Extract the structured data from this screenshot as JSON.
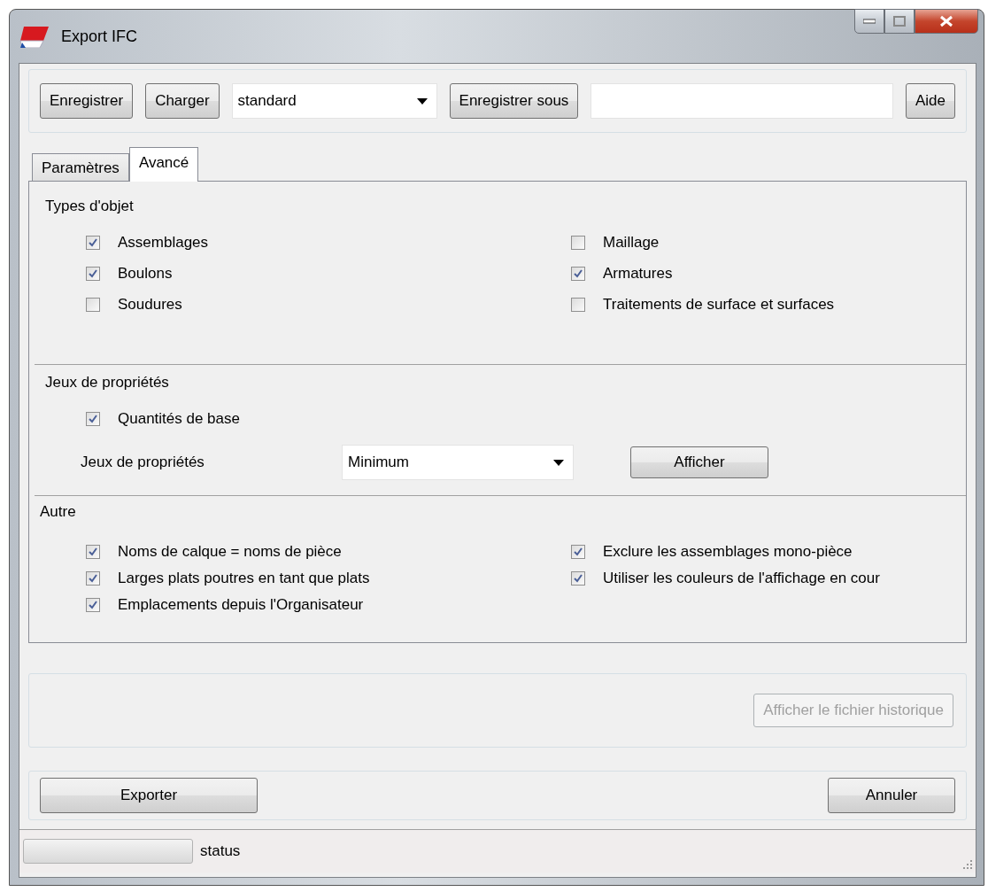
{
  "window": {
    "title": "Export IFC"
  },
  "toolbar": {
    "buttons": [
      "Enregistrer",
      "Charger"
    ],
    "preset": {
      "value": "standard"
    },
    "save_as_button": "Enregistrer sous",
    "name_field": {
      "kind": "text"
    },
    "help_button": "Aide"
  },
  "tabs": [
    {
      "label": "Paramètres",
      "selected": false
    },
    {
      "label": "Avancé",
      "selected": true
    }
  ],
  "object_types": {
    "title": "Types d'objet",
    "left": [
      {
        "label": "Assemblages",
        "checked": true
      },
      {
        "label": "Boulons",
        "checked": true
      },
      {
        "label": "Soudures",
        "checked": false
      }
    ],
    "right": [
      {
        "label": "Maillage",
        "checked": false
      },
      {
        "label": "Armatures",
        "checked": true
      },
      {
        "label": "Traitements de surface et surfaces",
        "checked": false
      }
    ]
  },
  "property_sets": {
    "title": "Jeux de propriétés",
    "base_quantities": {
      "label": "Quantités de base",
      "checked": true
    },
    "sets_label": "Jeux de propriétés",
    "sets_value": "Minimum",
    "show_button": "Afficher"
  },
  "other": {
    "title": "Autre",
    "left": [
      {
        "label": "Noms de calque = noms de pièce",
        "checked": true
      },
      {
        "label": "Larges plats poutres en tant que plats",
        "checked": true
      },
      {
        "label": "Emplacements depuis l'Organisateur",
        "checked": true
      }
    ],
    "right": [
      {
        "label": "Exclure les assemblages mono-pièce",
        "checked": true
      },
      {
        "label": "Utiliser les couleurs de l'affichage en cour",
        "checked": true
      }
    ]
  },
  "log_button": {
    "label": "Afficher le fichier historique",
    "disabled": true
  },
  "actions": {
    "export": "Exporter",
    "cancel": "Annuler"
  },
  "status_bar": {
    "progress": {
      "level": 0
    },
    "text": "status"
  }
}
